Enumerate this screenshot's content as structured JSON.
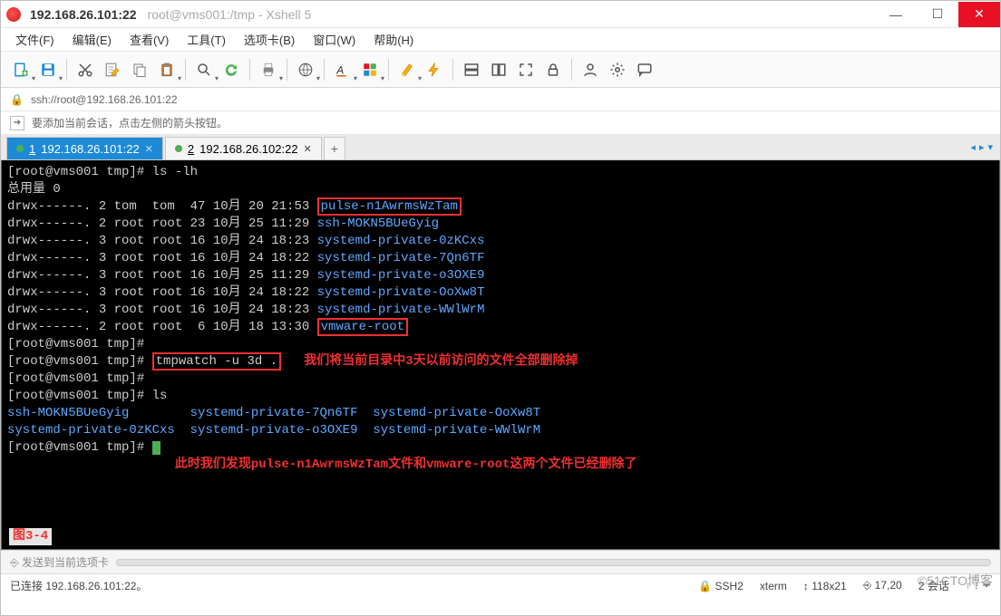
{
  "title": {
    "main": "192.168.26.101:22",
    "sub": "root@vms001:/tmp - Xshell 5"
  },
  "menu": [
    "文件(F)",
    "编辑(E)",
    "查看(V)",
    "工具(T)",
    "选项卡(B)",
    "窗口(W)",
    "帮助(H)"
  ],
  "address": "ssh://root@192.168.26.101:22",
  "tip": "要添加当前会话，点击左侧的箭头按钮。",
  "tabs": [
    {
      "num": "1",
      "label": "192.168.26.101:22",
      "active": true
    },
    {
      "num": "2",
      "label": "192.168.26.102:22",
      "active": false
    }
  ],
  "terminal": {
    "prompt": "[root@vms001 tmp]# ",
    "cmd_ls_lh": "ls -lh",
    "total": "总用量 0",
    "rows": [
      {
        "perm": "drwx------. 2 tom  tom  47 10月 20 21:53",
        "name": "pulse-n1AwrmsWzTam",
        "boxed": true
      },
      {
        "perm": "drwx------. 2 root root 23 10月 25 11:29",
        "name": "ssh-MOKN5BUeGyig",
        "boxed": false
      },
      {
        "perm": "drwx------. 3 root root 16 10月 24 18:23",
        "name": "systemd-private-0zKCxs",
        "boxed": false
      },
      {
        "perm": "drwx------. 3 root root 16 10月 24 18:22",
        "name": "systemd-private-7Qn6TF",
        "boxed": false
      },
      {
        "perm": "drwx------. 3 root root 16 10月 25 11:29",
        "name": "systemd-private-o3OXE9",
        "boxed": false
      },
      {
        "perm": "drwx------. 3 root root 16 10月 24 18:22",
        "name": "systemd-private-OoXw8T",
        "boxed": false
      },
      {
        "perm": "drwx------. 3 root root 16 10月 24 18:23",
        "name": "systemd-private-WWlWrM",
        "boxed": false
      },
      {
        "perm": "drwx------. 2 root root  6 10月 18 13:30",
        "name": "vmware-root",
        "boxed": true
      }
    ],
    "cmd_tmpwatch": "tmpwatch -u 3d .",
    "anno1": "我们将当前目录中3天以前访问的文件全部删除掉",
    "cmd_ls": "ls",
    "ls_line1_a": "ssh-MOKN5BUeGyig",
    "ls_line1_b": "systemd-private-7Qn6TF",
    "ls_line1_c": "systemd-private-OoXw8T",
    "ls_line2_a": "systemd-private-0zKCxs",
    "ls_line2_b": "systemd-private-o3OXE9",
    "ls_line2_c": "systemd-private-WWlWrM",
    "anno2": "此时我们发现pulse-n1AwrmsWzTam文件和vmware-root这两个文件已经删除了",
    "figure": "图3-4"
  },
  "bottom_hint": "发送到当前选项卡",
  "status": {
    "conn": "已连接 192.168.26.101:22。",
    "proto": "SSH2",
    "term": "xterm",
    "size": "118x21",
    "pos": "17,20",
    "sess": "2 会话"
  },
  "watermark": "©51CTO博客"
}
